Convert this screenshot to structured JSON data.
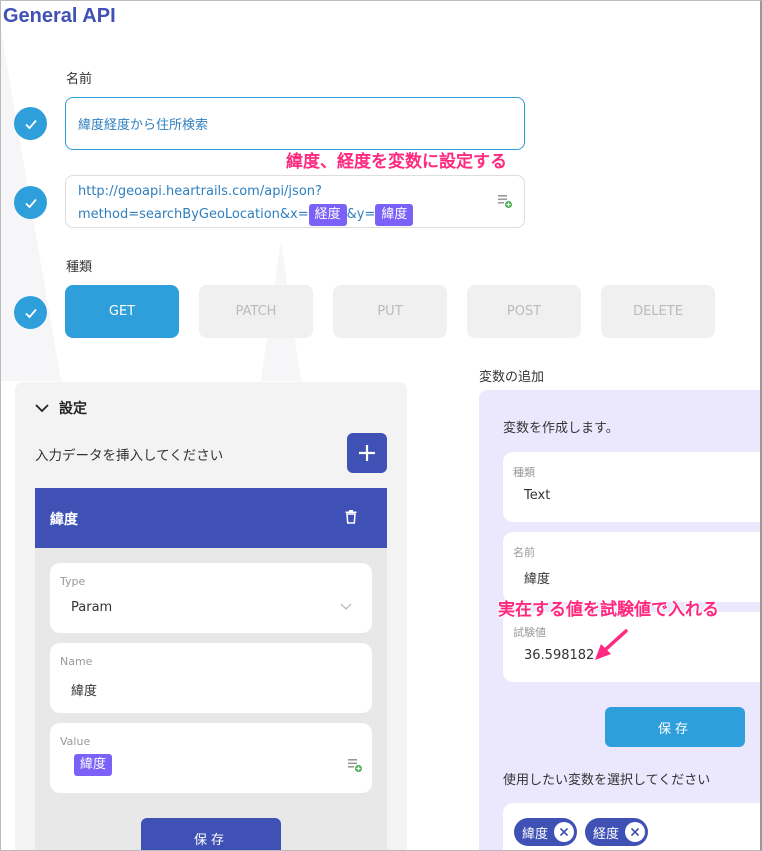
{
  "app": {
    "title": "General API"
  },
  "name_field": {
    "label": "名前",
    "value": "緯度経度から住所検索"
  },
  "annotations": {
    "latlng_vars": "緯度、経度を変数に設定する",
    "test_value": "実在する値を試験値で入れる"
  },
  "url_field": {
    "line1": "http://geoapi.heartrails.com/api/json?",
    "line2_prefix": "method=searchByGeoLocation&x=",
    "chip_x": "経度",
    "line2_mid": "&y=",
    "chip_y": "緯度"
  },
  "method": {
    "label": "種類",
    "options": [
      "GET",
      "PATCH",
      "PUT",
      "POST",
      "DELETE"
    ],
    "selected": "GET"
  },
  "settings": {
    "title": "設定",
    "insert_prompt": "入力データを挿入してください",
    "param": {
      "header": "緯度",
      "type_label": "Type",
      "type_value": "Param",
      "name_label": "Name",
      "name_value": "緯度",
      "value_label": "Value",
      "value_chip": "緯度"
    },
    "save_label": "保存"
  },
  "variables": {
    "section_label": "変数の追加",
    "intro": "変数を作成します。",
    "kind_label": "種類",
    "kind_value": "Text",
    "name_label": "名前",
    "name_value": "緯度",
    "test_label": "試験値",
    "test_value": "36.598182",
    "save_label": "保存",
    "select_prompt": "使用したい変数を選択してください",
    "selected_vars": [
      "緯度",
      "経度"
    ]
  },
  "colors": {
    "primary": "#2f9fdc",
    "indigo": "#3f51b5",
    "chip": "#7b61f7",
    "annotation": "#ff2a7f",
    "var_panel_bg": "#ebe8fd"
  }
}
